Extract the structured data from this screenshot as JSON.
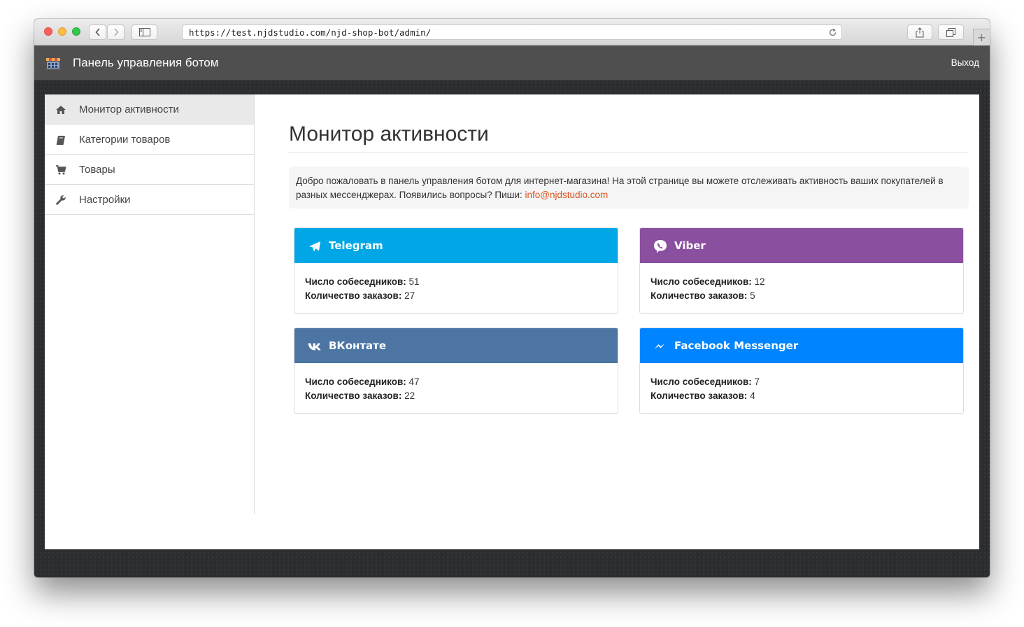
{
  "browser": {
    "url": "https://test.njdstudio.com/njd-shop-bot/admin/",
    "new_tab": "+"
  },
  "navbar": {
    "brand": "Панель управления ботом",
    "logout": "Выход"
  },
  "sidebar": {
    "items": [
      {
        "label": "Монитор активности",
        "icon": "home-icon",
        "active": true
      },
      {
        "label": "Категории товаров",
        "icon": "book-icon",
        "active": false
      },
      {
        "label": "Товары",
        "icon": "cart-icon",
        "active": false
      },
      {
        "label": "Настройки",
        "icon": "wrench-icon",
        "active": false
      }
    ]
  },
  "main": {
    "title": "Монитор активности",
    "welcome_text": "Добро пожаловать в панель управления ботом для интернет-магазина! На этой странице вы можете отслеживать активность ваших покупателей в разных мессенджерах. Появились вопросы? Пиши: ",
    "welcome_email": "info@njdstudio.com"
  },
  "stats": {
    "label_users": "Число собеседников:",
    "label_orders": "Количество заказов:"
  },
  "cards": [
    {
      "name": "Telegram",
      "icon": "telegram-icon",
      "color": "#00a6e6",
      "users": "51",
      "orders": "27"
    },
    {
      "name": "Viber",
      "icon": "viber-icon",
      "color": "#8a4f9e",
      "users": "12",
      "orders": "5"
    },
    {
      "name": "ВКонтате",
      "icon": "vk-icon",
      "color": "#4c75a3",
      "users": "47",
      "orders": "22"
    },
    {
      "name": "Facebook Messenger",
      "icon": "messenger-icon",
      "color": "#0084ff",
      "users": "7",
      "orders": "4"
    }
  ]
}
